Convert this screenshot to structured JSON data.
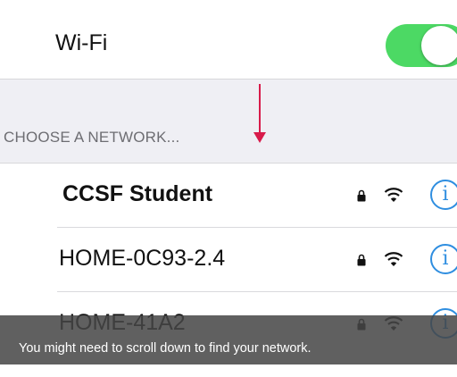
{
  "wifi": {
    "label": "Wi-Fi",
    "toggle_on": true,
    "toggle_color": "#4cd964"
  },
  "section_header": "CHOOSE A NETWORK...",
  "annotation_arrow_color": "#d81b4a",
  "networks": [
    {
      "name": "CCSF Student",
      "secured": true,
      "icons": [
        "lock-icon",
        "wifi-icon",
        "info-icon"
      ]
    },
    {
      "name": "HOME-0C93-2.4",
      "secured": true,
      "icons": [
        "lock-icon",
        "wifi-icon",
        "info-icon"
      ]
    },
    {
      "name": "HOME-41A2",
      "secured": true,
      "icons": [
        "lock-icon",
        "wifi-icon",
        "info-icon"
      ]
    }
  ],
  "info_glyph": "i",
  "info_color": "#2f8ee0",
  "overlay_caption": "You might need to scroll down to find your network."
}
